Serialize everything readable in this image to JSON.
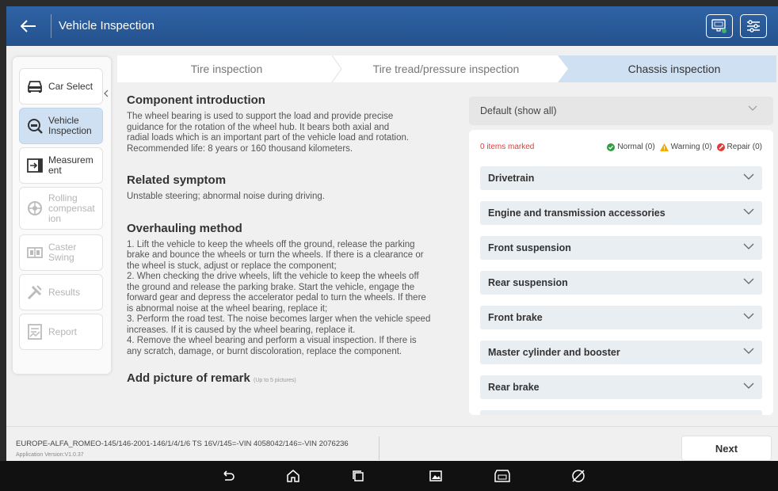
{
  "titlebar": {
    "title": "Vehicle Inspection",
    "back_icon": "arrow-left-icon",
    "right_icons": [
      "vci-connection-icon",
      "settings-sliders-icon"
    ]
  },
  "sidebar": {
    "items": [
      {
        "label": "Car Select",
        "icon": "car-icon",
        "state": "normal"
      },
      {
        "label": "Vehicle Inspection",
        "icon": "inspection-magnifier-icon",
        "state": "active"
      },
      {
        "label": "Measurement",
        "icon": "measurement-icon",
        "state": "normal"
      },
      {
        "label": "Rolling compensation",
        "icon": "rolling-wheel-icon",
        "state": "disabled"
      },
      {
        "label": "Caster Swing",
        "icon": "caster-icon",
        "state": "disabled"
      },
      {
        "label": "Results",
        "icon": "results-icon",
        "state": "disabled"
      },
      {
        "label": "Report",
        "icon": "report-icon",
        "state": "disabled"
      }
    ],
    "item_lines": {
      "car_select": [
        "Car Select"
      ],
      "vehicle_inspection": [
        "Vehicle",
        "Inspection"
      ],
      "measurement": [
        "Measurem",
        "ent"
      ],
      "rolling": [
        "Rolling",
        "compensat",
        "ion"
      ],
      "caster": [
        "Caster",
        "Swing"
      ],
      "results": [
        "Results"
      ],
      "report": [
        "Report"
      ]
    }
  },
  "steps": [
    {
      "label": "Tire inspection",
      "active": false
    },
    {
      "label": "Tire tread/pressure inspection",
      "active": false
    },
    {
      "label": "Chassis inspection",
      "active": true
    }
  ],
  "content": {
    "intro_title": "Component introduction",
    "intro_lines": [
      "The wheel bearing is used to support the load and provide precise",
      "guidance for the rotation of the wheel hub. It bears both axial and",
      "radial loads which is an important part of the vehicle load and rotation.",
      "Recommended life: 8 years or 160 thousand kilometers."
    ],
    "symptom_title": "Related symptom",
    "symptom_text": "Unstable steering; abnormal noise during driving.",
    "method_title": "Overhauling method",
    "method_lines": [
      "1. Lift the vehicle to keep the wheels off the ground, release the parking",
      "brake and bounce the wheels or turn the wheels. If there is a clearance or",
      "the wheel is stuck, adjust or replace the component;",
      "2. When checking the drive wheels, lift the vehicle to keep the wheels off",
      "the ground and release the parking brake. Start the vehicle, engage the",
      "forward gear and depress the accelerator pedal to turn the wheels. If there",
      "is abnormal noise at the wheel bearing, replace it;",
      "3. Perform the road test. The noise becomes larger when the vehicle speed",
      "increases. If it is caused by the wheel bearing, replace it.",
      "4. Remove the wheel bearing and perform a visual inspection. If there is",
      "any scratch, damage, or burnt discoloration, replace the component."
    ],
    "picture_title": "Add picture of remark",
    "picture_hint": "(Up to 5 pictures)"
  },
  "panel": {
    "filter_selected": "Default (show all)",
    "marked_count": "0 items marked",
    "legend": {
      "normal": "Normal (0)",
      "warning": "Warning (0)",
      "repair": "Repair (0)"
    },
    "colors": {
      "normal": "#2e9e44",
      "warning": "#f2a900",
      "repair": "#e53935"
    },
    "categories": [
      "Drivetrain",
      "Engine and transmission accessories",
      "Front suspension",
      "Rear suspension",
      "Front brake",
      "Master cylinder and booster",
      "Rear brake"
    ]
  },
  "footer": {
    "vehicle_info": "EUROPE-ALFA_ROMEO-145/146-2001-146/1/4/1/6 TS 16V/145=-VIN 4058042/146=-VIN 2076236",
    "version": "Application Version:V1.0.37",
    "next_label": "Next"
  },
  "android_nav": [
    "back-icon",
    "home-icon",
    "recents-icon",
    "screenshot-icon",
    "vci-icon",
    "browser-icon"
  ]
}
